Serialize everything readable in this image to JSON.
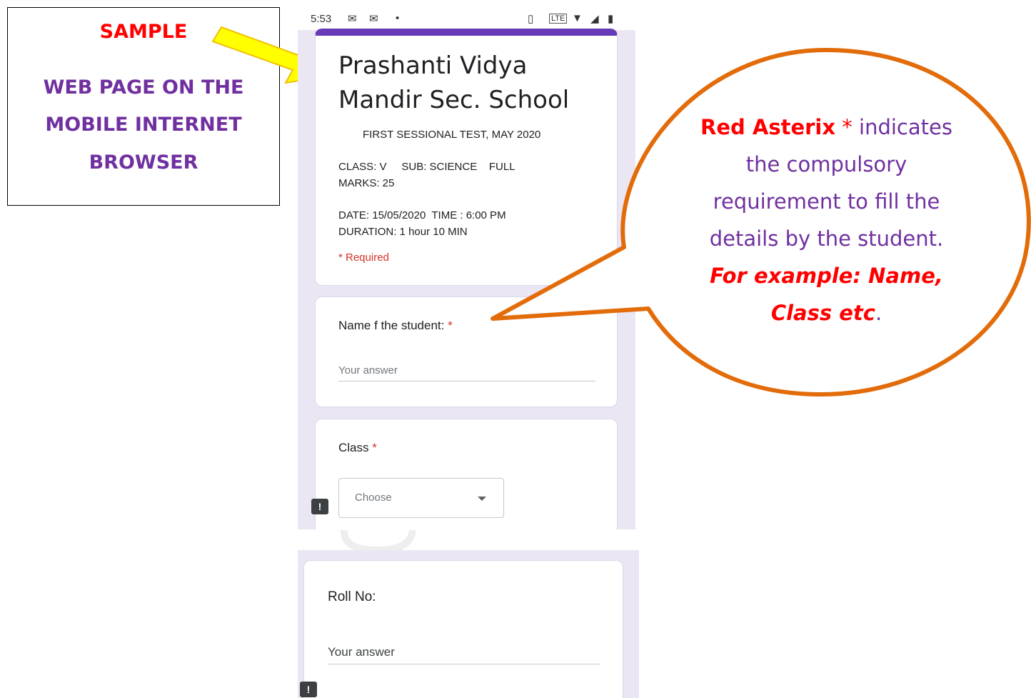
{
  "annotation": {
    "sample": "SAMPLE",
    "line1": "WEB PAGE ON THE",
    "line2": "MOBILE INTERNET",
    "line3": "BROWSER"
  },
  "status_bar": {
    "time": "5:53",
    "dot": "•"
  },
  "form": {
    "title_line1": "Prashanti Vidya",
    "title_line2": "Mandir Sec. School",
    "subtitle": "FIRST SESSIONAL TEST, MAY 2020",
    "info1_line1": "CLASS: V     SUB: SCIENCE    FULL",
    "info1_line2": "MARKS: 25",
    "info2_line1": "DATE: 15/05/2020  TIME : 6:00 PM",
    "info2_line2": "DURATION: 1 hour 10 MIN",
    "required_note": "* Required"
  },
  "questions": {
    "name_label": "Name f the student:",
    "name_placeholder": "Your answer",
    "class_label": "Class",
    "class_choose": "Choose",
    "roll_label": "Roll No:",
    "roll_placeholder": "Your answer",
    "asterisk": "*"
  },
  "bubble": {
    "b1": "Red Asterix",
    "b2": "*",
    "b3": " indicates",
    "b4": "the compulsory",
    "b5": "requirement to fill the",
    "b6": "details by the student.",
    "b7": "For example: Name,",
    "b8": "Class etc",
    "b9": "."
  },
  "icons": {
    "report": "!"
  },
  "colors": {
    "accent": "#673ab7",
    "required_red": "#d93025",
    "annotation_purple": "#7030a0",
    "annotation_red": "#ff0000",
    "bubble_stroke": "#e36c0a",
    "arrow_fill": "#ffff00"
  }
}
